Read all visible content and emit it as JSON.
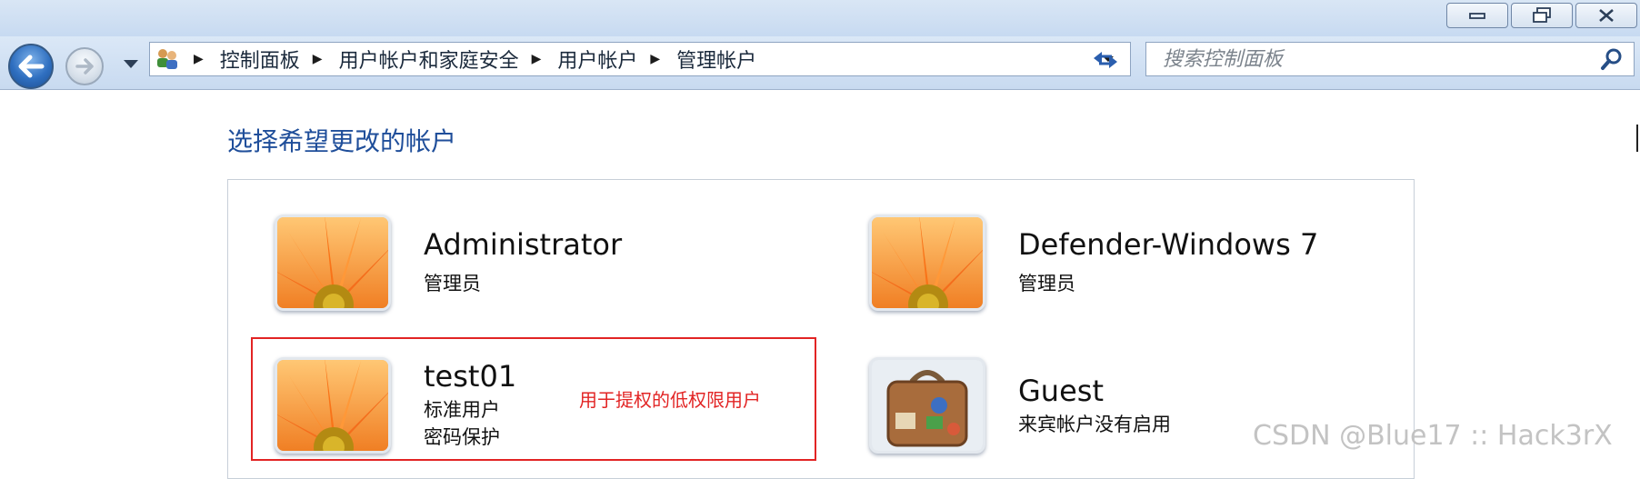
{
  "window": {
    "caption_buttons": [
      {
        "name": "minimize-button",
        "icon": "minimize-icon"
      },
      {
        "name": "restore-button",
        "icon": "restore-icon"
      },
      {
        "name": "close-button",
        "icon": "close-icon"
      }
    ]
  },
  "navbar": {
    "address_icon": "user-accounts-icon",
    "breadcrumbs": [
      "控制面板",
      "用户帐户和家庭安全",
      "用户帐户",
      "管理帐户"
    ],
    "search_placeholder": "搜索控制面板"
  },
  "page": {
    "title": "选择希望更改的帐户",
    "accounts": [
      {
        "name": "Administrator",
        "line1": "管理员",
        "line2": "",
        "picture": "flower"
      },
      {
        "name": "Defender-Windows 7",
        "line1": "管理员",
        "line2": "",
        "picture": "flower"
      },
      {
        "name": "test01",
        "line1": "标准用户",
        "line2": "密码保护",
        "picture": "flower"
      },
      {
        "name": "Guest",
        "line1": "来宾帐户没有启用",
        "line2": "",
        "picture": "suitcase"
      }
    ],
    "annotation": "用于提权的低权限用户",
    "watermark": "CSDN @Blue17 :: Hack3rX"
  },
  "colors": {
    "title": "#1f4e9a",
    "annotation": "#e22424",
    "watermark": "#c3c3c3"
  }
}
